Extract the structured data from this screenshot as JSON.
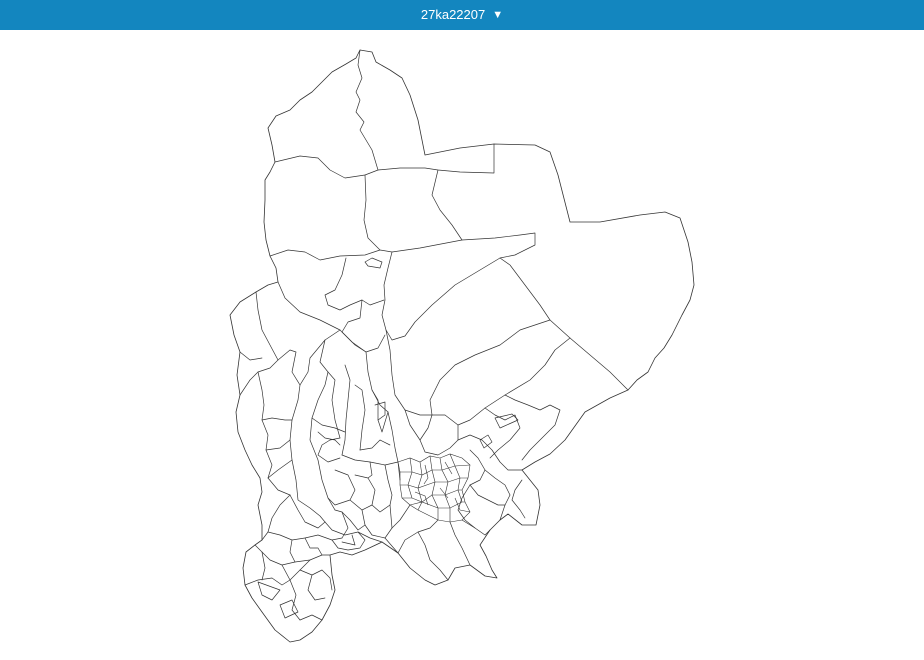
{
  "header": {
    "area_code": "27ka22207",
    "dropdown_caret": "▼",
    "background_color": "#1386bf",
    "text_color": "#ffffff"
  },
  "map": {
    "type": "choropleth-boundaries",
    "fill_color": "#ffffff",
    "stroke_color": "#333333"
  }
}
